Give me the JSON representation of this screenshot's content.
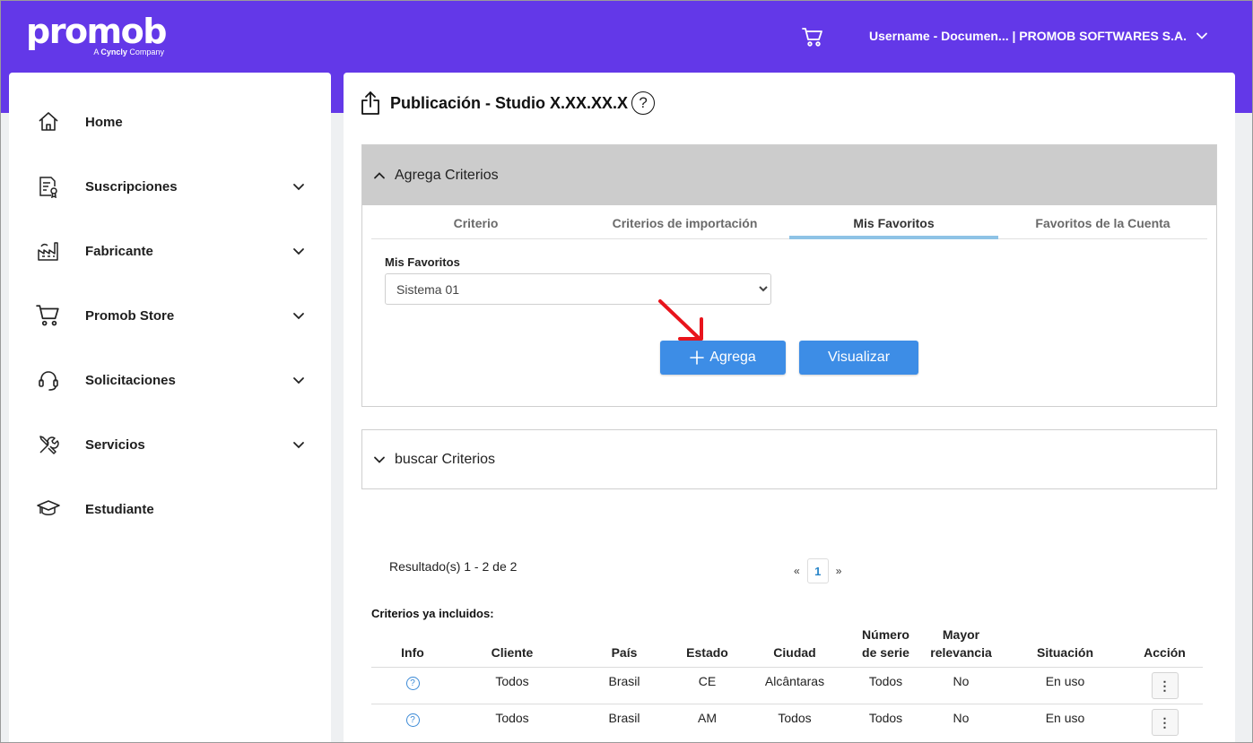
{
  "brand": {
    "name": "promob",
    "tagline_prefix": "A ",
    "tagline_brand": "Cyncly",
    "tagline_suffix": " Company"
  },
  "header": {
    "user_label": "Username - Documen... | PROMOB SOFTWARES S.A."
  },
  "sidebar": {
    "items": [
      {
        "label": "Home",
        "icon": "home-icon",
        "expandable": false
      },
      {
        "label": "Suscripciones",
        "icon": "certificate-icon",
        "expandable": true
      },
      {
        "label": "Fabricante",
        "icon": "factory-icon",
        "expandable": true
      },
      {
        "label": "Promob Store",
        "icon": "cart-icon",
        "expandable": true
      },
      {
        "label": "Solicitaciones",
        "icon": "headset-icon",
        "expandable": true
      },
      {
        "label": "Servicios",
        "icon": "tools-icon",
        "expandable": true
      },
      {
        "label": "Estudiante",
        "icon": "graduation-cap-icon",
        "expandable": false
      }
    ]
  },
  "page": {
    "title": "Publicación - Studio X.XX.XX.X",
    "help_symbol": "?"
  },
  "add_criteria": {
    "header": "Agrega Criterios",
    "tabs": [
      "Criterio",
      "Criterios de importación",
      "Mis Favoritos",
      "Favoritos de la Cuenta"
    ],
    "active_tab": 2,
    "field_label": "Mis Favoritos",
    "select_value": "Sistema 01",
    "add_button": "Agrega",
    "view_button": "Visualizar"
  },
  "search_criteria": {
    "header": "buscar Criterios"
  },
  "results": {
    "summary": "Resultado(s) 1 - 2 de 2",
    "pager": {
      "prev": "«",
      "current": "1",
      "next": "»"
    }
  },
  "included": {
    "title": "Criterios ya incluidos:",
    "columns": [
      "Info",
      "Cliente",
      "País",
      "Estado",
      "Ciudad",
      "Número de serie",
      "Mayor relevancia",
      "Situación",
      "Acción"
    ],
    "rows": [
      {
        "info": "?",
        "cliente": "Todos",
        "pais": "Brasil",
        "estado": "CE",
        "ciudad": "Alcântaras",
        "serie": "Todos",
        "relevancia": "No",
        "situacion": "En uso",
        "accion": "⋮"
      },
      {
        "info": "?",
        "cliente": "Todos",
        "pais": "Brasil",
        "estado": "AM",
        "ciudad": "Todos",
        "serie": "Todos",
        "relevancia": "No",
        "situacion": "En uso",
        "accion": "⋮"
      }
    ]
  },
  "colors": {
    "header_bg": "#6338e8",
    "button_bg": "#3d8de6",
    "tab_underline": "#8ec3e6",
    "annotation_arrow": "#e8141c"
  }
}
